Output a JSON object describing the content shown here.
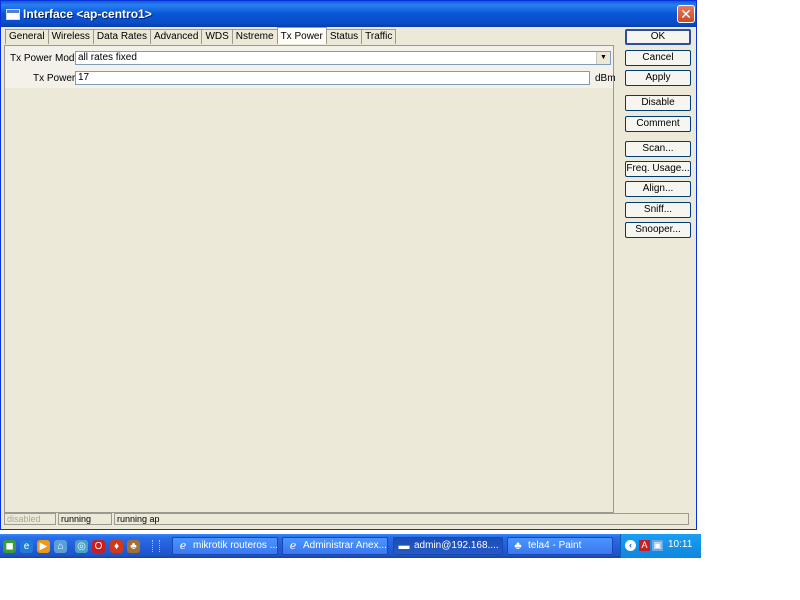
{
  "window": {
    "title": "Interface <ap-centro1>",
    "close_glyph": "✕"
  },
  "tabs": [
    {
      "label": "General"
    },
    {
      "label": "Wireless"
    },
    {
      "label": "Data Rates"
    },
    {
      "label": "Advanced"
    },
    {
      "label": "WDS"
    },
    {
      "label": "Nstreme"
    },
    {
      "label": "Tx Power"
    },
    {
      "label": "Status"
    },
    {
      "label": "Traffic"
    }
  ],
  "active_tab": "Tx Power",
  "form": {
    "mode_label": "Tx Power Mode:",
    "mode_value": "all rates fixed",
    "power_label": "Tx Power:",
    "power_value": "17",
    "power_unit": "dBm"
  },
  "buttons": {
    "ok": "OK",
    "cancel": "Cancel",
    "apply": "Apply",
    "disable": "Disable",
    "comment": "Comment",
    "scan": "Scan...",
    "freq_usage": "Freq. Usage...",
    "align": "Align...",
    "sniff": "Sniff...",
    "snooper": "Snooper..."
  },
  "status_bar": {
    "disabled": "disabled",
    "running": "running",
    "running_ap": "running ap"
  },
  "taskbar": {
    "quick_launch_icons": [
      "desktop-icon",
      "ie-icon",
      "media-icon",
      "network-icon",
      "app-icon",
      "opera-icon",
      "shield-icon",
      "winbox-icon"
    ],
    "tasks": [
      {
        "label": "mikrotik routeros ...",
        "icon": "ie-icon"
      },
      {
        "label": "Administrar Anex...",
        "icon": "ie-icon"
      },
      {
        "label": "admin@192.168....",
        "icon": "terminal-icon"
      },
      {
        "label": "tela4 - Paint",
        "icon": "paint-icon"
      }
    ],
    "clock": "10:11"
  },
  "colors": {
    "titlebar": "#0a5bd8",
    "window_bg": "#ece9d8",
    "taskbar": "#245edb",
    "tray": "#0f86dd"
  }
}
